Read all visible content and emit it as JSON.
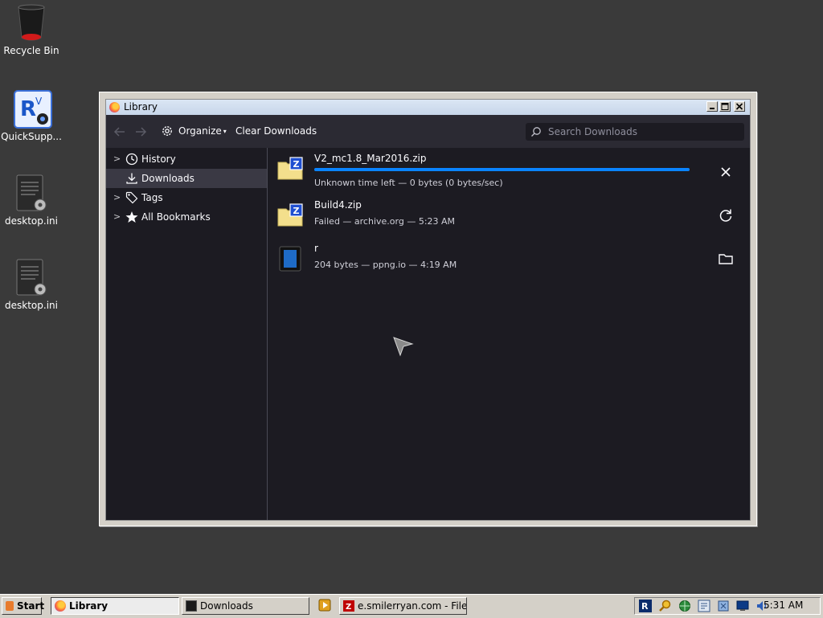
{
  "desktop": {
    "icons": [
      {
        "label": "Recycle Bin"
      },
      {
        "label": "QuickSupp..."
      },
      {
        "label": "desktop.ini"
      },
      {
        "label": "desktop.ini"
      }
    ]
  },
  "window": {
    "title": "Library",
    "toolbar": {
      "organize_label": "Organize",
      "clear_label": "Clear Downloads",
      "search_placeholder": "Search Downloads"
    },
    "sidebar": {
      "items": [
        {
          "label": "History",
          "selected": false
        },
        {
          "label": "Downloads",
          "selected": true
        },
        {
          "label": "Tags",
          "selected": false
        },
        {
          "label": "All Bookmarks",
          "selected": false
        }
      ]
    },
    "downloads": [
      {
        "name": "V2_mc1.8_Mar2016.zip",
        "status": "Unknown time left — 0 bytes (0 bytes/sec)",
        "action_icon": "cancel-icon",
        "in_progress": true
      },
      {
        "name": "Build4.zip",
        "status": "Failed — archive.org — 5:23 AM",
        "action_icon": "retry-icon",
        "in_progress": false
      },
      {
        "name": "r",
        "status": "204 bytes — ppng.io — 4:19 AM",
        "action_icon": "folder-icon",
        "in_progress": false
      }
    ]
  },
  "taskbar": {
    "start_label": "Start",
    "tasks": [
      {
        "label": "Library",
        "active": true
      },
      {
        "label": "Downloads",
        "active": false
      },
      {
        "label": "e.smilerryan.com - File...",
        "active": false
      }
    ],
    "clock": "5:31 AM"
  },
  "colors": {
    "desktop_bg": "#3a3a3a",
    "window_bg": "#1c1b22",
    "toolbar_bg": "#2b2a33",
    "selected_bg": "#3a3944",
    "accent": "#0a84ff"
  }
}
